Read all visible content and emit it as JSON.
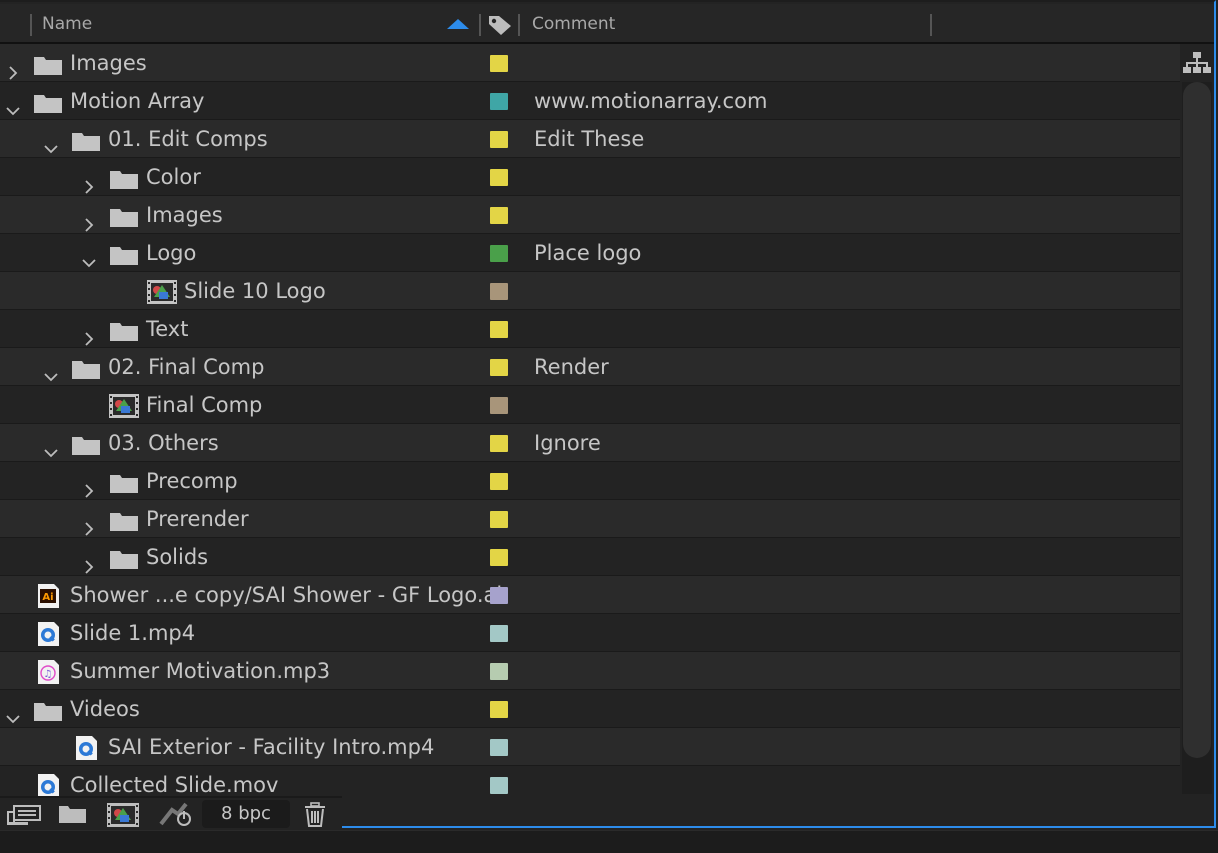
{
  "header": {
    "name_label": "Name",
    "comment_label": "Comment"
  },
  "rows": [
    {
      "name": "Images",
      "type": "folder",
      "arrow": "right",
      "comment": "",
      "color": "#e3d546"
    },
    {
      "name": "Motion Array",
      "type": "folder",
      "arrow": "down",
      "comment": "www.motionarray.com",
      "color": "#3fa6a6"
    },
    {
      "name": "01. Edit Comps",
      "type": "folder",
      "arrow": "down",
      "comment": "Edit These",
      "color": "#e3d546"
    },
    {
      "name": "Color",
      "type": "folder",
      "arrow": "right",
      "comment": "",
      "color": "#e3d546"
    },
    {
      "name": "Images",
      "type": "folder",
      "arrow": "right",
      "comment": "",
      "color": "#e3d546"
    },
    {
      "name": "Logo",
      "type": "folder",
      "arrow": "down",
      "comment": "Place logo",
      "color": "#4aa04a"
    },
    {
      "name": "Slide 10 Logo",
      "type": "comp",
      "arrow": "",
      "comment": "",
      "color": "#a8957a"
    },
    {
      "name": "Text",
      "type": "folder",
      "arrow": "right",
      "comment": "",
      "color": "#e3d546"
    },
    {
      "name": "02. Final Comp",
      "type": "folder",
      "arrow": "down",
      "comment": "Render",
      "color": "#e3d546"
    },
    {
      "name": "Final Comp",
      "type": "comp",
      "arrow": "",
      "comment": "",
      "color": "#a8957a"
    },
    {
      "name": "03. Others",
      "type": "folder",
      "arrow": "down",
      "comment": "Ignore",
      "color": "#e3d546"
    },
    {
      "name": "Precomp",
      "type": "folder",
      "arrow": "right",
      "comment": "",
      "color": "#e3d546"
    },
    {
      "name": "Prerender",
      "type": "folder",
      "arrow": "right",
      "comment": "",
      "color": "#e3d546"
    },
    {
      "name": "Solids",
      "type": "folder",
      "arrow": "right",
      "comment": "",
      "color": "#e3d546"
    },
    {
      "name": "Shower ...e copy/SAI Shower - GF Logo.ai",
      "type": "ai",
      "arrow": "",
      "comment": "",
      "color": "#a6a2cc"
    },
    {
      "name": "Slide 1.mp4",
      "type": "video",
      "arrow": "",
      "comment": "",
      "color": "#a3c8c6"
    },
    {
      "name": "Summer Motivation.mp3",
      "type": "audio",
      "arrow": "",
      "comment": "",
      "color": "#b6ccb0"
    },
    {
      "name": "Videos",
      "type": "folder",
      "arrow": "down",
      "comment": "",
      "color": "#e3d546"
    },
    {
      "name": "SAI Exterior - Facility Intro.mp4",
      "type": "video",
      "arrow": "",
      "comment": "",
      "color": "#a3c8c6"
    },
    {
      "name": "Collected Slide.mov",
      "type": "video",
      "arrow": "",
      "comment": "",
      "color": "#a3c8c6"
    }
  ],
  "footer": {
    "bpc_label": "8 bpc"
  },
  "icons": {
    "sort": "sort-ascending-icon",
    "label": "label-tag-icon",
    "folder": "folder-icon",
    "comp": "composition-icon",
    "ai": "illustrator-file-icon",
    "video": "quicktime-icon",
    "audio": "audio-file-icon",
    "flowchart": "flowchart-icon",
    "interpret": "interpret-footage-icon",
    "new_folder": "new-folder-icon",
    "new_comp": "new-composition-icon",
    "render": "project-settings-icon",
    "trash": "trash-icon"
  }
}
